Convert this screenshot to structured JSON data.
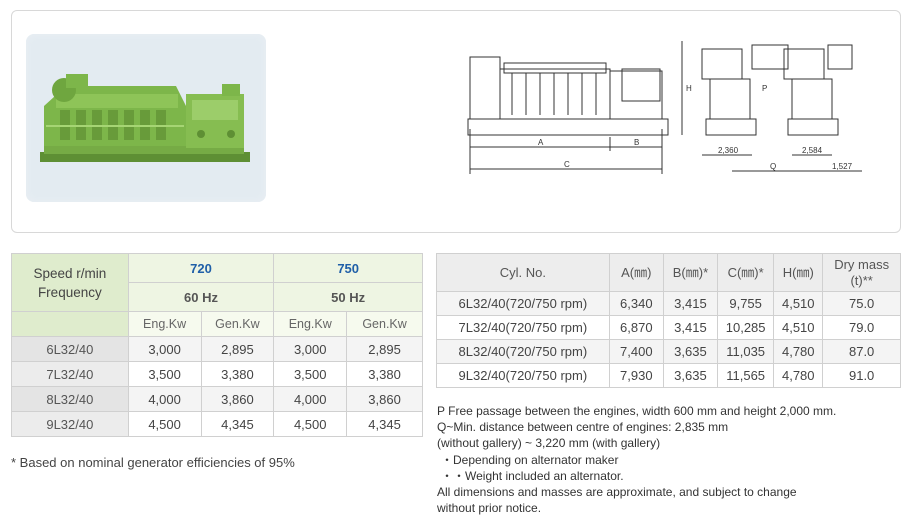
{
  "performance": {
    "header": {
      "speed_label_1": "Speed r/min",
      "speed_label_2": "Frequency",
      "speed_720": "720",
      "speed_750": "750",
      "freq_60": "60 Hz",
      "freq_50": "50 Hz",
      "eng_kw": "Eng.Kw",
      "gen_kw": "Gen.Kw"
    },
    "rows": [
      {
        "model": "6L32/40",
        "e720": "3,000",
        "g720": "2,895",
        "e750": "3,000",
        "g750": "2,895"
      },
      {
        "model": "7L32/40",
        "e720": "3,500",
        "g720": "3,380",
        "e750": "3,500",
        "g750": "3,380"
      },
      {
        "model": "8L32/40",
        "e720": "4,000",
        "g720": "3,860",
        "e750": "4,000",
        "g750": "3,860"
      },
      {
        "model": "9L32/40",
        "e720": "4,500",
        "g720": "4,345",
        "e750": "4,500",
        "g750": "4,345"
      }
    ],
    "footnote": "* Based on nominal generator efficiencies of 95%"
  },
  "dimensions": {
    "header": {
      "cyl": "Cyl. No.",
      "a": "A(㎜)",
      "b": "B(㎜)*",
      "c": "C(㎜)*",
      "h": "H(㎜)",
      "mass_1": "Dry mass",
      "mass_2": "(t)**"
    },
    "rows": [
      {
        "cyl": "6L32/40(720/750 rpm)",
        "a": "6,340",
        "b": "3,415",
        "c": "9,755",
        "h": "4,510",
        "m": "75.0"
      },
      {
        "cyl": "7L32/40(720/750 rpm)",
        "a": "6,870",
        "b": "3,415",
        "c": "10,285",
        "h": "4,510",
        "m": "79.0"
      },
      {
        "cyl": "8L32/40(720/750 rpm)",
        "a": "7,400",
        "b": "3,635",
        "c": "11,035",
        "h": "4,780",
        "m": "87.0"
      },
      {
        "cyl": "9L32/40(720/750 rpm)",
        "a": "7,930",
        "b": "3,635",
        "c": "11,565",
        "h": "4,780",
        "m": "91.0"
      }
    ],
    "notes": {
      "p": "P Free passage between the engines, width 600 mm and height 2,000 mm.",
      "q1": "Q~Min. distance between centre of engines: 2,835 mm",
      "q2": "(without gallery) ~ 3,220 mm (with gallery)",
      "star1": "・Depending on alternator maker",
      "star2": "・・Weight included an alternator.",
      "all1": "All dimensions and masses are approximate, and subject to change",
      "all2": "without prior notice."
    }
  },
  "drawing": {
    "labels": {
      "a": "A",
      "b": "B",
      "c": "C",
      "h": "H",
      "p": "P",
      "q": "Q",
      "d1": "2,360",
      "d2": "2,584",
      "d3": "1,527"
    }
  },
  "colors": {
    "engine_green": "#7db64a",
    "header_green": "#dfeccd",
    "link_blue": "#1f5fa8"
  }
}
